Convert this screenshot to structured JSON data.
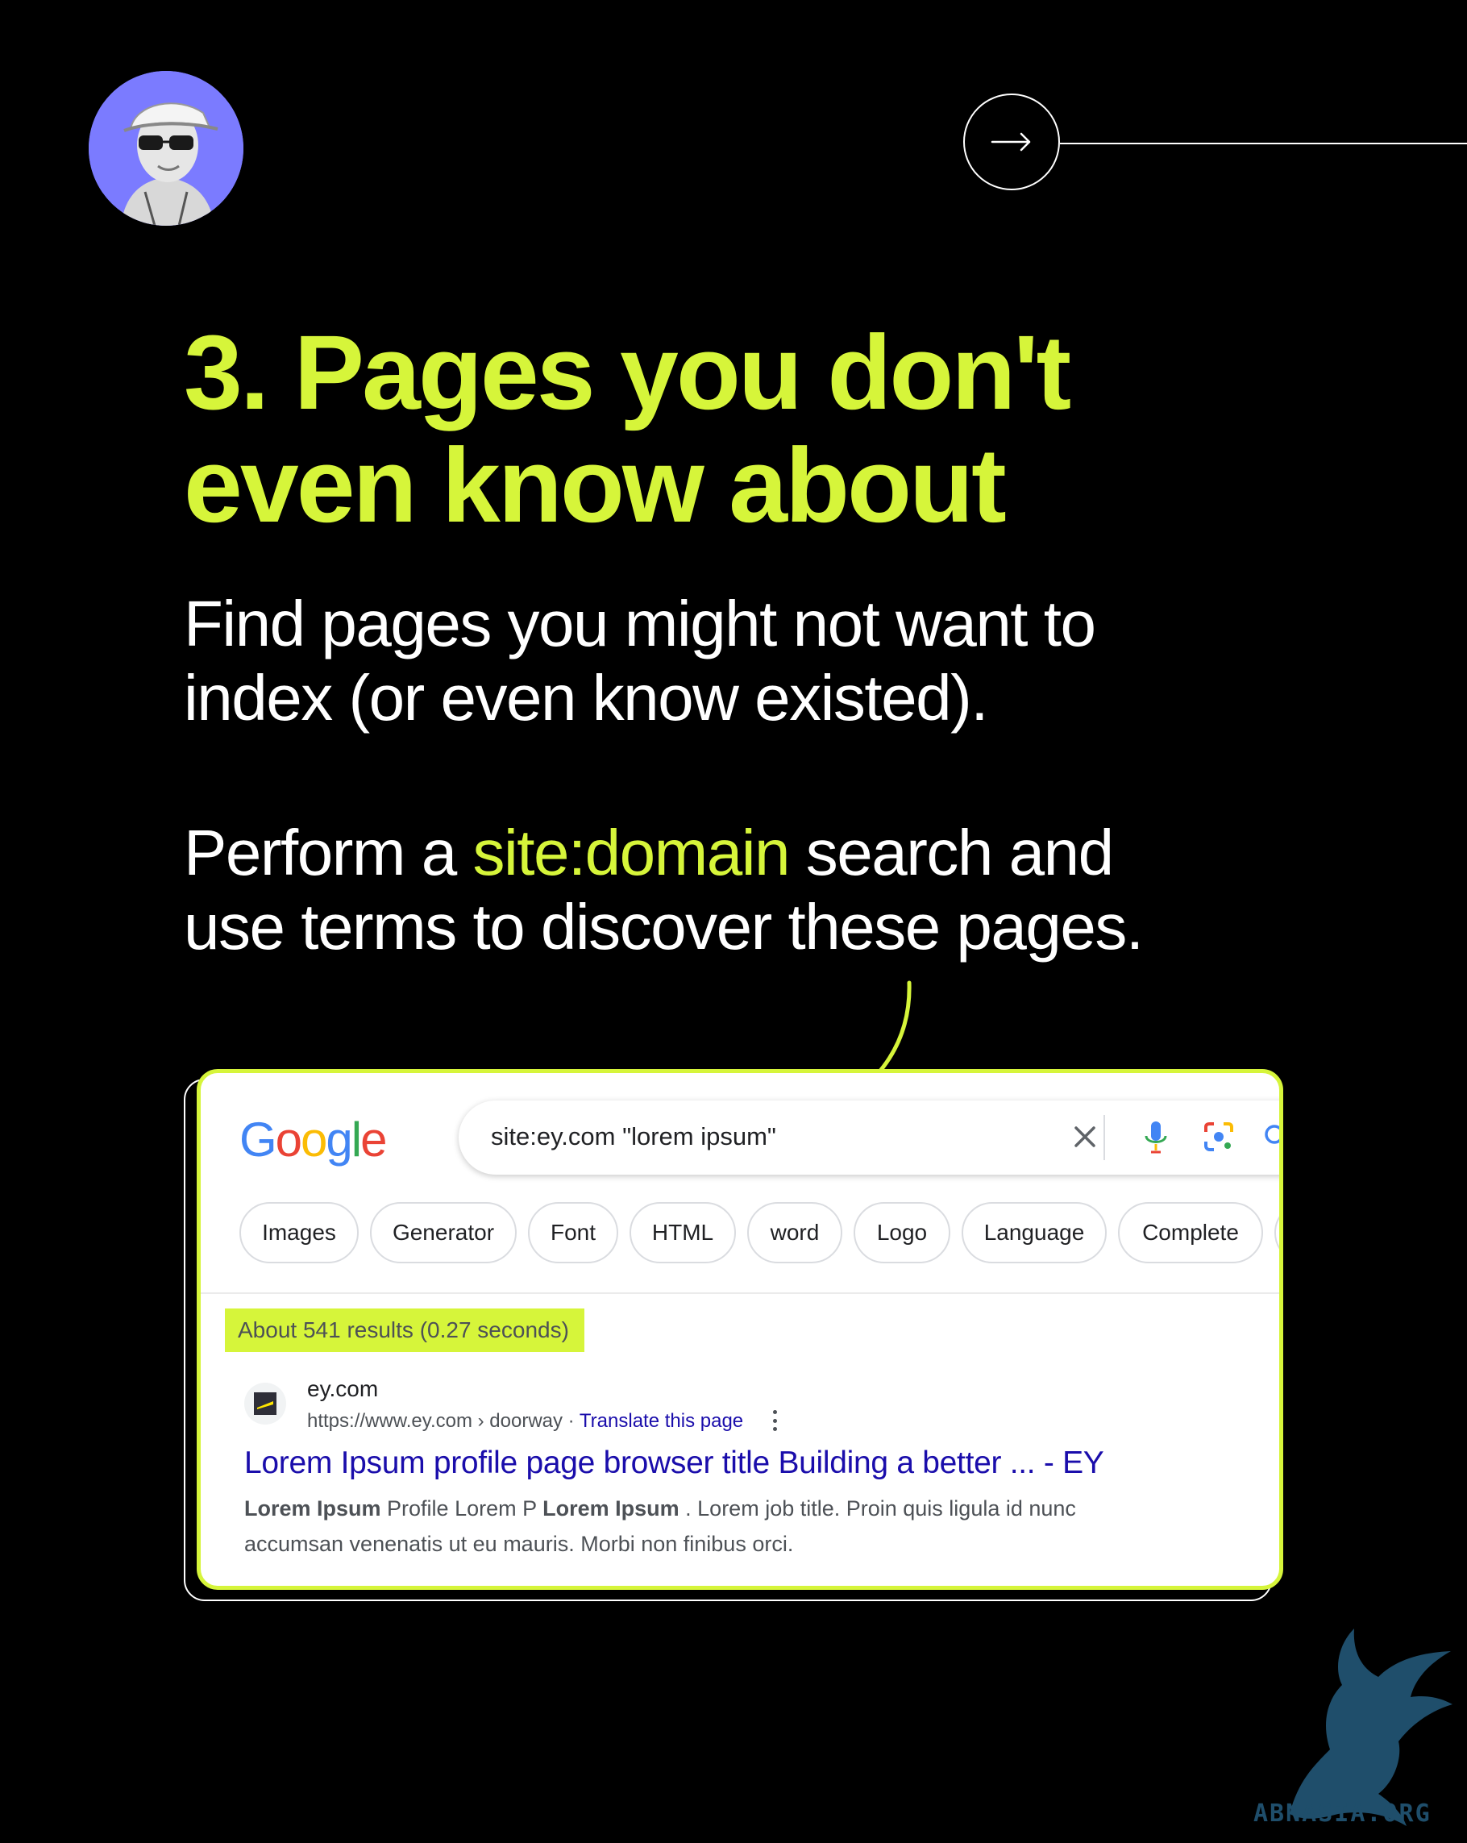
{
  "header": {
    "avatar_icon": "person-with-cap-sunglasses-avatar",
    "next_icon": "arrow-right-icon"
  },
  "headline": {
    "line1": "3. Pages  you don't",
    "line2": "even know about"
  },
  "paragraph1": {
    "line1": "Find pages  you might not want to",
    "line2": "index (or even know existed)."
  },
  "paragraph2": {
    "prefix": "Perform a ",
    "highlight": "site:domain",
    "suffix_line1": " search and",
    "line2": "use terms to discover these pages."
  },
  "colors": {
    "background": "#000000",
    "accent": "#d6f53a",
    "text": "#ffffff",
    "link": "#1a0dab"
  },
  "search": {
    "logo": [
      "G",
      "o",
      "o",
      "g",
      "l",
      "e"
    ],
    "logo_colors": [
      "#4285F4",
      "#EA4335",
      "#FBBC05",
      "#4285F4",
      "#34A853",
      "#EA4335"
    ],
    "query": "site:ey.com \"lorem ipsum\"",
    "icons": [
      "clear-icon",
      "microphone-icon",
      "lens-icon",
      "search-icon"
    ],
    "chips": [
      "Images",
      "Generator",
      "Font",
      "HTML",
      "word",
      "Logo",
      "Language",
      "Complete"
    ],
    "stats": "About 541 results (0.27 seconds)",
    "result": {
      "site_name": "ey.com",
      "url": "https://www.ey.com › doorway",
      "separator": " · ",
      "translate": "Translate this page",
      "title": "Lorem Ipsum profile page browser title Building a better ... - EY",
      "snippet": {
        "b1": "Lorem Ipsum",
        "t1": " Profile Lorem P ",
        "b2": "Lorem Ipsum",
        "t2": " . Lorem job title. Proin quis ligula id nunc",
        "line2": "accumsan venenatis ut eu mauris. Morbi non finibus orci."
      }
    }
  },
  "watermark": {
    "text": "ABNASIA.ORG"
  }
}
